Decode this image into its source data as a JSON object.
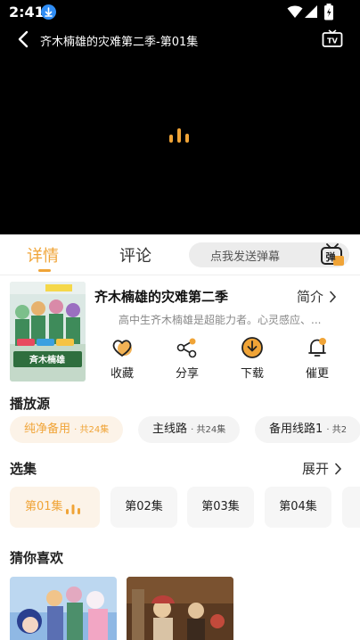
{
  "status_bar": {
    "time": "2:41",
    "icons": [
      "download-icon",
      "wifi-icon",
      "signal-icon",
      "battery-icon"
    ]
  },
  "player": {
    "title": "齐木楠雄的灾难第二季-第01集",
    "state": "loading"
  },
  "tabs": [
    {
      "label": "详情",
      "active": true
    },
    {
      "label": "评论",
      "active": false
    }
  ],
  "danmaku": {
    "placeholder": "点我发送弹幕",
    "button": "弹"
  },
  "show": {
    "title": "齐木楠雄的灾难第二季",
    "intro_label": "简介",
    "synopsis": "高中生齐木楠雄是超能力者。心灵感应、...",
    "actions": [
      {
        "label": "收藏",
        "icon": "heart-icon"
      },
      {
        "label": "分享",
        "icon": "share-icon"
      },
      {
        "label": "下载",
        "icon": "download-icon"
      },
      {
        "label": "催更",
        "icon": "bell-icon"
      }
    ]
  },
  "sources": {
    "title": "播放源",
    "items": [
      {
        "name": "纯净备用",
        "count": "共24集",
        "active": true
      },
      {
        "name": "主线路",
        "count": "共24集",
        "active": false
      },
      {
        "name": "备用线路1",
        "count": "共2",
        "active": false
      }
    ]
  },
  "episodes": {
    "title": "选集",
    "expand_label": "展开",
    "items": [
      {
        "label": "第01集",
        "active": true
      },
      {
        "label": "第02集",
        "active": false
      },
      {
        "label": "第03集",
        "active": false
      },
      {
        "label": "第04集",
        "active": false
      }
    ]
  },
  "recommend": {
    "title": "猜你喜欢"
  },
  "colors": {
    "accent": "#f0a437",
    "accent_bg": "#fcf3e8",
    "video_bg": "#000000"
  }
}
